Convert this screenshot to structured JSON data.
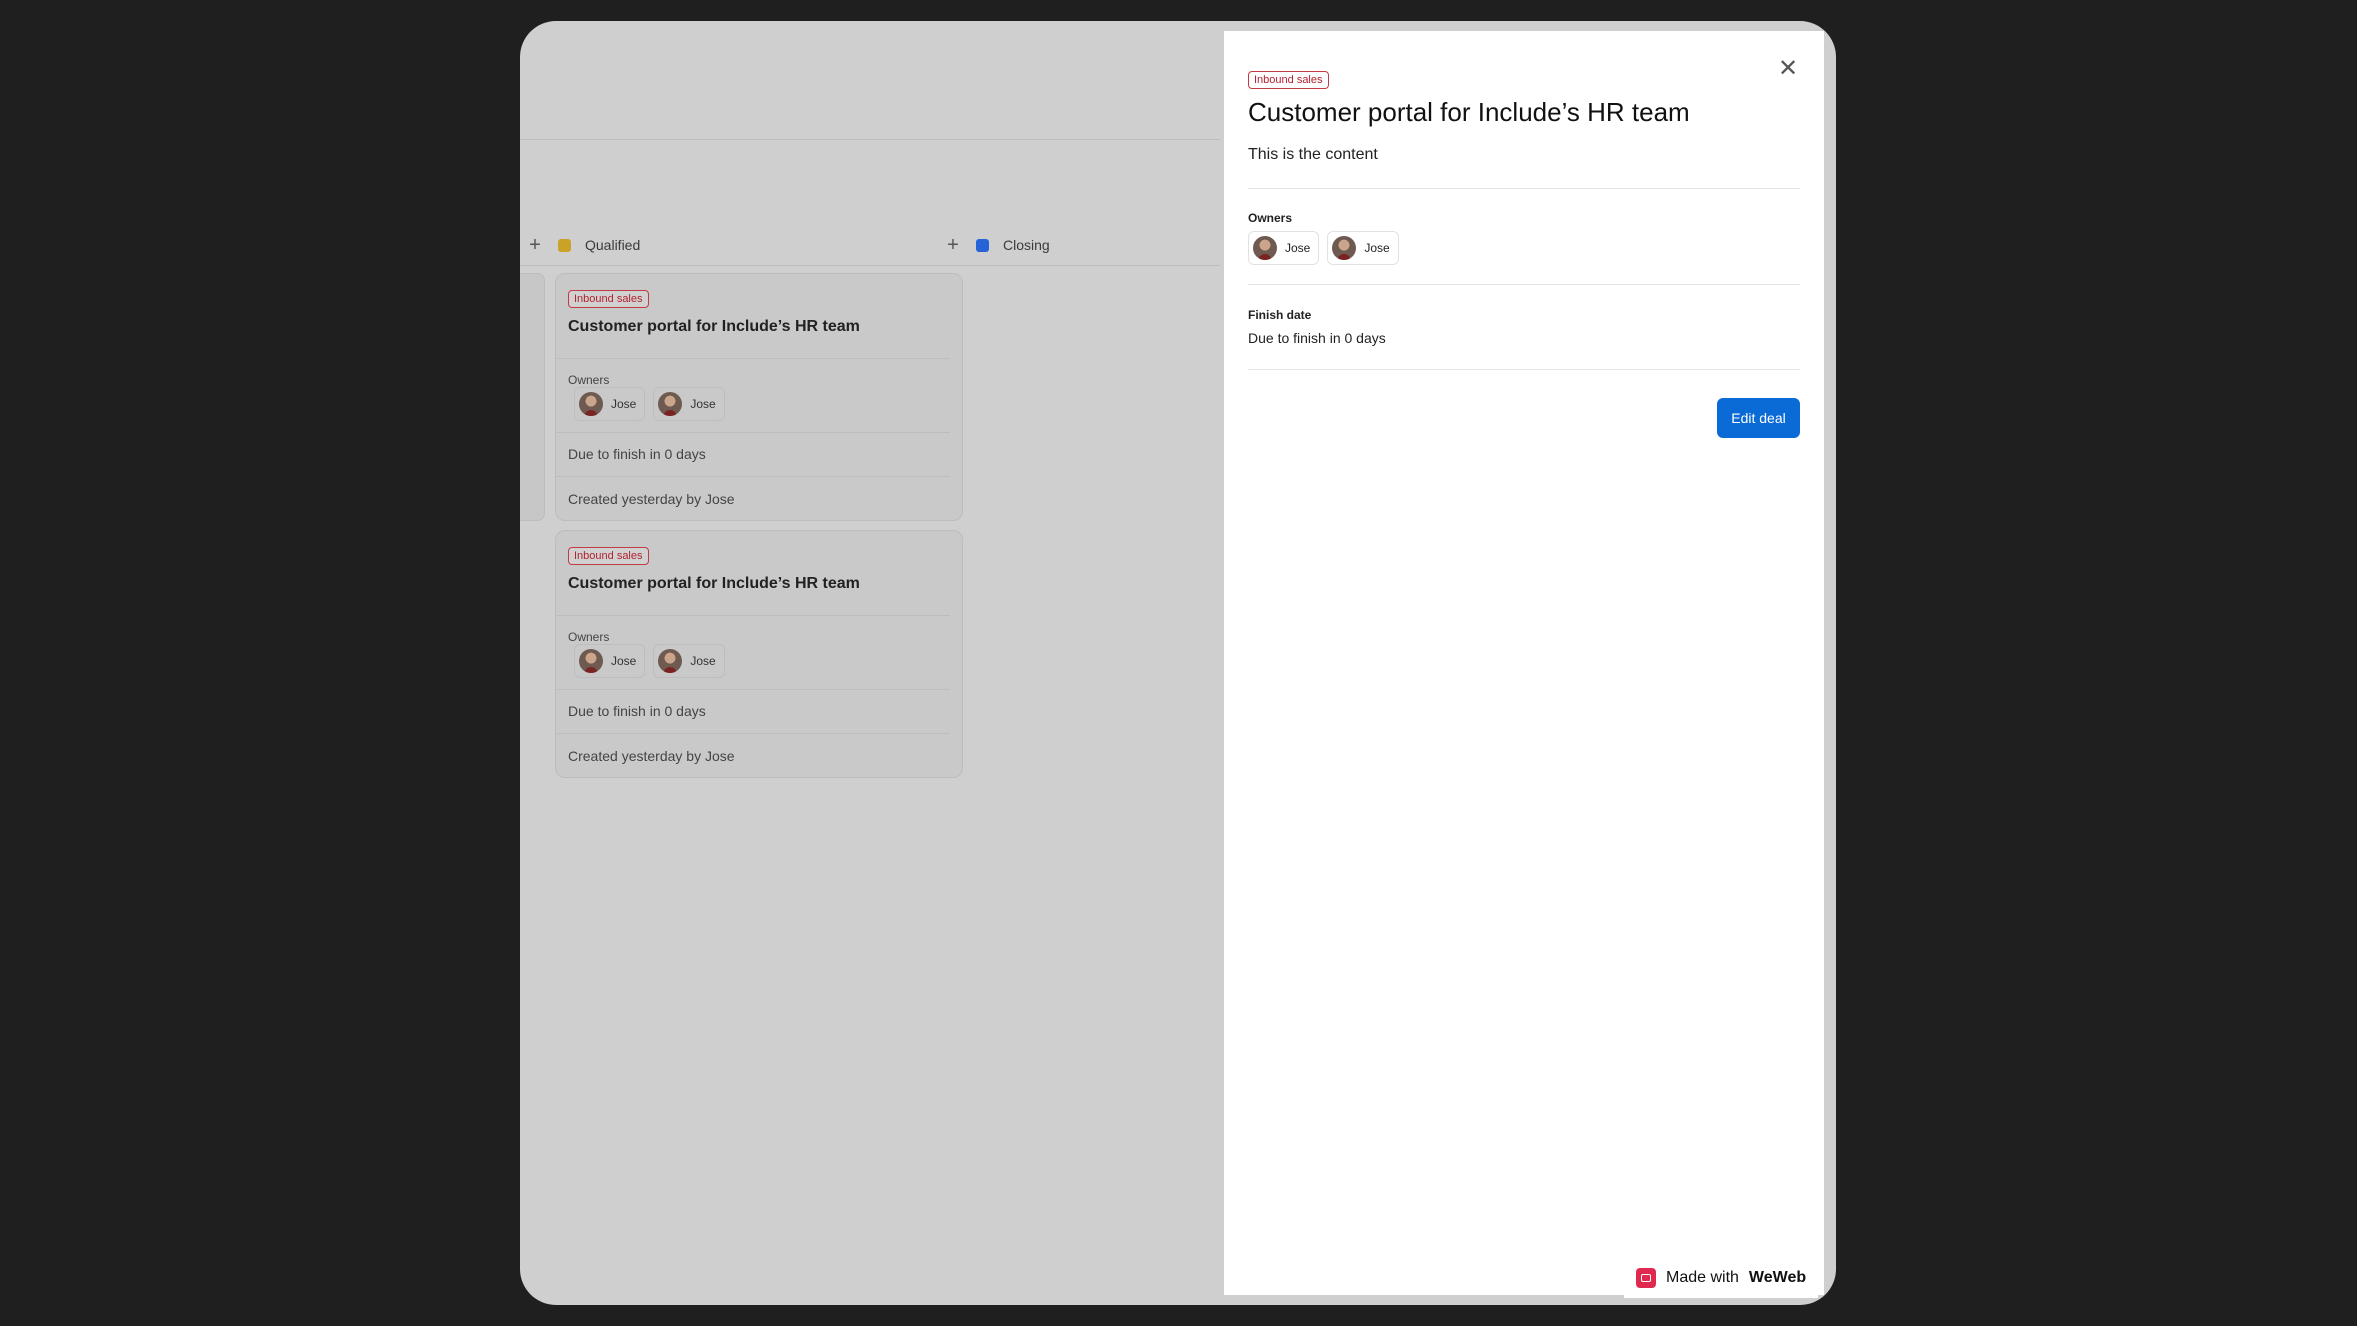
{
  "board": {
    "columns": [
      {
        "name": "Qualified",
        "color": "#c9a227",
        "add_icon": "plus-icon"
      },
      {
        "name": "Closing",
        "color": "#2563d6",
        "add_icon": "plus-icon"
      }
    ],
    "cards": [
      {
        "tag": "Inbound sales",
        "title": "Customer portal for Include’s HR team",
        "owners_label": "Owners",
        "owners": [
          "Jose",
          "Jose"
        ],
        "due": "Due to finish in 0 days",
        "created": "Created yesterday by Jose"
      },
      {
        "tag": "Inbound sales",
        "title": "Customer portal for Include’s HR team",
        "owners_label": "Owners",
        "owners": [
          "Jose",
          "Jose"
        ],
        "due": "Due to finish in 0 days",
        "created": "Created yesterday by Jose"
      }
    ]
  },
  "panel": {
    "close_icon": "close-icon",
    "tag": "Inbound sales",
    "title": "Customer portal for Include’s HR team",
    "content": "This is the content",
    "owners_label": "Owners",
    "owners": [
      "Jose",
      "Jose"
    ],
    "finish_label": "Finish date",
    "due": "Due to finish in 0 days",
    "edit_button": "Edit deal"
  },
  "badge": {
    "prefix": "Made with",
    "brand": "WeWeb",
    "brand_color": "#e0294f"
  },
  "colors": {
    "tag_red": "#c23a44",
    "primary_blue": "#0a6bd6"
  }
}
